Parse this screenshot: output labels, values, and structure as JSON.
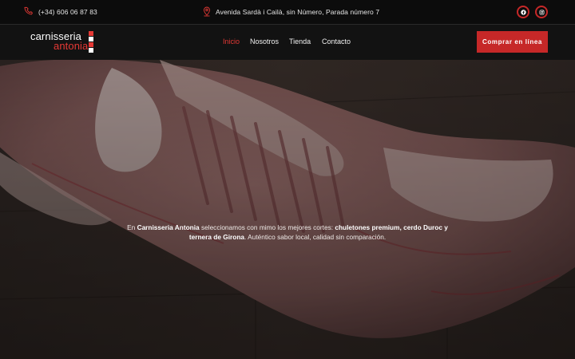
{
  "topbar": {
    "phone_icon": "phone-icon",
    "phone": "(+34) 606 06 87 83",
    "location_icon": "location-pin-icon",
    "address": "Avenida Sardà i Cailà, sin Número, Parada número 7",
    "socials": [
      {
        "icon": "facebook-icon"
      },
      {
        "icon": "instagram-icon"
      }
    ]
  },
  "header": {
    "logo": {
      "line1": "carnisseria",
      "line2": "antonia"
    },
    "nav": [
      {
        "label": "Inicio",
        "active": true
      },
      {
        "label": "Nosotros",
        "active": false
      },
      {
        "label": "Tienda",
        "active": false
      },
      {
        "label": "Contacto",
        "active": false
      }
    ],
    "cta_label": "Comprar en línea"
  },
  "hero": {
    "p1": "En ",
    "b1": "Carnisseria Antonia",
    "p2": " seleccionamos con mimo los mejores cortes: ",
    "b2": "chuletones premium, cerdo Duroc y ternera de Girona",
    "p3": ". Auténtico sabor local, calidad sin comparación."
  },
  "colors": {
    "accent": "#c62828",
    "active_nav": "#e53935",
    "topbar_bg": "#0c0c0c",
    "navbar_bg": "#121212"
  }
}
